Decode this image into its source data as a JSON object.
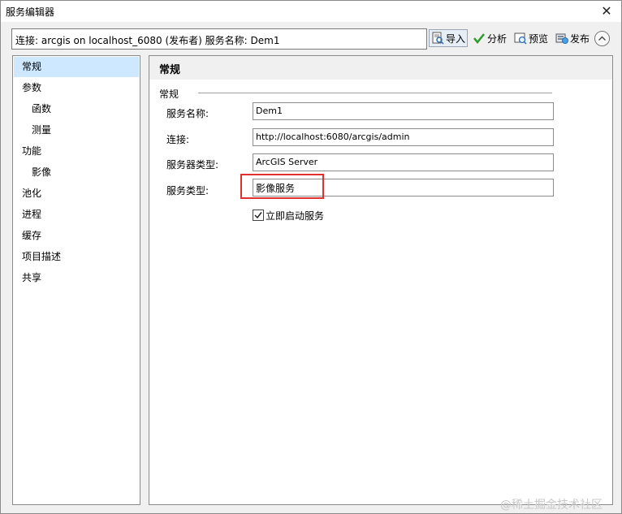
{
  "window": {
    "title": "服务编辑器"
  },
  "toolbar": {
    "connection_text": "连接: arcgis on localhost_6080 (发布者)    服务名称: Dem1",
    "import_label": "导入",
    "analyze_label": "分析",
    "preview_label": "预览",
    "publish_label": "发布"
  },
  "sidebar": {
    "items": [
      {
        "label": "常规",
        "selected": true
      },
      {
        "label": "参数"
      },
      {
        "label": "函数"
      },
      {
        "label": "测量"
      },
      {
        "label": "功能"
      },
      {
        "label": "影像"
      },
      {
        "label": "池化"
      },
      {
        "label": "进程"
      },
      {
        "label": "缓存"
      },
      {
        "label": "项目描述"
      },
      {
        "label": "共享"
      }
    ]
  },
  "panel": {
    "title": "常规",
    "group_label": "常规",
    "fields": [
      {
        "label": "服务名称:",
        "value": "Dem1"
      },
      {
        "label": "连接:",
        "value": "http://localhost:6080/arcgis/admin"
      },
      {
        "label": "服务器类型:",
        "value": "ArcGIS Server"
      },
      {
        "label": "服务类型:",
        "value": "影像服务"
      }
    ],
    "start_service": {
      "label": "立即启动服务",
      "checked": true
    }
  },
  "watermark": "@稀土掘金技术社区",
  "colors": {
    "selection": "#cde8ff",
    "highlight_box": "#e03030",
    "check_green": "#2a9d2a"
  }
}
